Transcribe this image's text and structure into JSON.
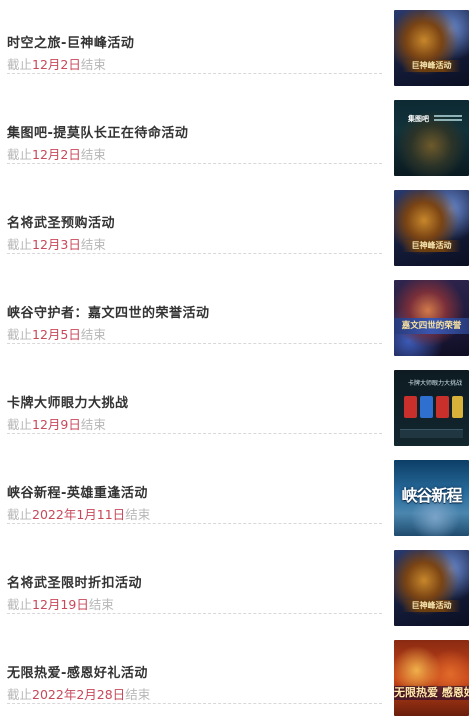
{
  "labels": {
    "deadline_prefix": "截止",
    "deadline_suffix": "结束"
  },
  "colors": {
    "title": "#333333",
    "deadline_text": "#b7b7b7",
    "deadline_date": "#c8485a",
    "divider": "#d8d8d8"
  },
  "items": [
    {
      "title": "时空之旅-巨神峰活动",
      "date": "12月2日",
      "thumb_caption": "巨神峰活动"
    },
    {
      "title": "集图吧-提莫队长正在待命活动",
      "date": "12月2日",
      "thumb_caption": "集图吧"
    },
    {
      "title": "名将武圣预购活动",
      "date": "12月3日",
      "thumb_caption": "巨神峰活动"
    },
    {
      "title": "峡谷守护者：嘉文四世的荣誉活动",
      "date": "12月5日",
      "thumb_caption": "嘉文四世的荣誉"
    },
    {
      "title": "卡牌大师眼力大挑战",
      "date": "12月9日",
      "thumb_caption": "卡牌大师眼力大挑战"
    },
    {
      "title": "峡谷新程-英雄重逢活动",
      "date": "2022年1月11日",
      "thumb_caption": "峡谷新程"
    },
    {
      "title": "名将武圣限时折扣活动",
      "date": "12月19日",
      "thumb_caption": "巨神峰活动"
    },
    {
      "title": "无限热爱-感恩好礼活动",
      "date": "2022年2月28日",
      "thumb_caption": "无限热爱 感恩好礼"
    }
  ]
}
